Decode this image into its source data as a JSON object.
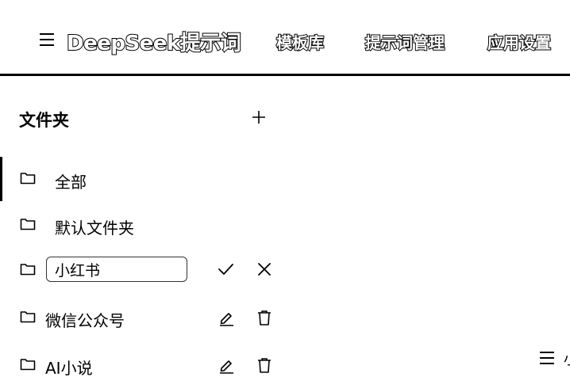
{
  "header": {
    "brand": "DeepSeek提示词",
    "nav": [
      "模板库",
      "提示词管理",
      "应用设置"
    ]
  },
  "sidebar": {
    "title": "文件夹",
    "folders": [
      {
        "label": "全部"
      },
      {
        "label": "默认文件夹"
      },
      {
        "label": "小红书",
        "editing": true
      },
      {
        "label": "微信公众号"
      },
      {
        "label": "AI小说"
      }
    ]
  },
  "footer_peek": {
    "text": "小"
  }
}
